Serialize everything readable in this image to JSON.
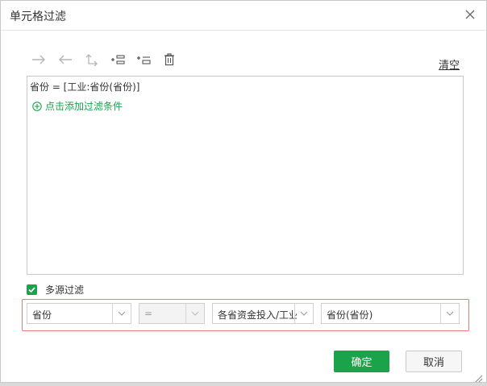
{
  "dialog": {
    "title": "单元格过滤",
    "close_icon": "close-icon"
  },
  "toolbar": {
    "icons": [
      "arrow-right-icon",
      "arrow-left-icon",
      "hierarchy-icon",
      "insert-before-icon",
      "insert-after-icon",
      "trash-icon"
    ],
    "clear_label": "清空"
  },
  "editor": {
    "expression": "省份 = [工业:省份(省份)]",
    "add_condition_label": "点击添加过滤条件"
  },
  "multi_source": {
    "label": "多源过滤",
    "checked": true
  },
  "filter_row": {
    "field": "省份",
    "operator": "=",
    "dataset": "各省资金投入/工业",
    "target_field": "省份(省份)"
  },
  "buttons": {
    "ok": "确定",
    "cancel": "取消"
  },
  "colors": {
    "accent": "#1aa34a",
    "highlight_border": "#e8787a"
  }
}
